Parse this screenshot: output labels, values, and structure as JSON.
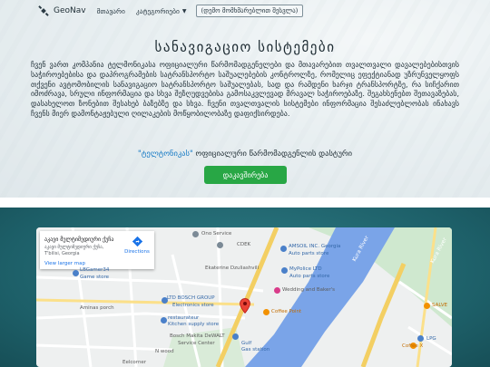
{
  "navbar": {
    "brand": "GeoNav",
    "items": [
      "მთავარი",
      "კატეგორიები"
    ],
    "button": "(დემო მომხმარებლით შესვლა)"
  },
  "hero": {
    "title": "სანავიგაციო სისტემები",
    "text": "ჩვენ ვართ კომპანია ტელმონიკასა  ოფიციალური წარმომადგენელები  და  მთავარებით  თვალთვალი დავალებებისთვის  საჭიროებებისა  და  დაპროგრამების  სატრანსპორტო  საშუალებების კონტროლზე, რომელიც ეფექტიანად  უზრუნველყოფს თქვენი ავტომობილის  სანავიგაციო სატრანსპორტო საშუალებას, სად და რამდენი ხარჯი ტრანსპორტზე, რა სიჩქარით იმოძრავა, სრული ინფორმაცია და სხვა შეზღუდვებისა გამოსაკვლევად მრავალ საჭიროებაზე. შეგახსენებთ შეთავაზებას, დასახელოთ ზონებით შესახებ ბაზებზე და სხვა. ჩვენი თვალთვალის სისტემები ინფორმაცია შესაძლებლობას ინახავს ჩვენს მიერ დამონტაჟებული ღილაკების მოწყობილობაზე დაფიქსირდება.",
    "link_highlight": "\"ტელტონიკას\"",
    "link_rest": " ოფიციალური წარმომადგენლის დასტური",
    "cta": "დაკავშირება"
  },
  "map": {
    "infobox": {
      "name": "აკავი მულტიმედიური ქუჩა",
      "address": "აკავი მულტიმედიური ქუჩა, T'bilisi, Georgia",
      "directions": "Directions",
      "larger": "View larger map"
    },
    "labels": {
      "ono": "Ono Service",
      "cdek": "CDEK",
      "amsoil": "AMSOIL INC. Georgia",
      "amsoil_sub": "Auto parts store",
      "kura1": "Kura River",
      "kura2": "Kura River",
      "ekaterine": "Ekaterine Dzuliashvili",
      "mypolice": "MyPolice LTD",
      "mypolice_sub": "Auto parts store",
      "lbgamer": "LBGamer34",
      "gamestore": "Game store",
      "wedding": "Wedding and Baker's",
      "bosch": "LTD BOSCH GROUP",
      "bosch_sub": "Electronics store",
      "aminas": "Aminas porch",
      "coffeepoint": "Coffee Point",
      "restaurateur": "restaurateur",
      "restaurateur_sub": "Kitchen supply store",
      "salve": "SALVE",
      "boschmakita": "Bosch Makita DeWALT",
      "service": "Service Center",
      "lpg": "LPG",
      "gulf": "Gulf",
      "gas": "Gas station",
      "coffeex": "Coffee X",
      "nwood": "N wood",
      "eelcorner": "Eelcorner"
    }
  }
}
